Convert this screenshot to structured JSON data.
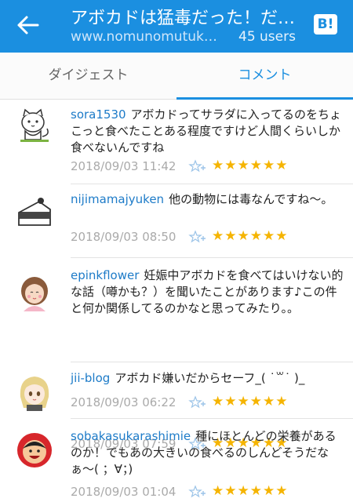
{
  "header": {
    "title": "アボカドは猛毒だった！だ…",
    "url": "www.nomunomutuk…",
    "users": "45 users",
    "hatena_label": "B!",
    "bg_color": "#1b8fe0"
  },
  "tabs": [
    {
      "label": "ダイジェスト",
      "selected": false
    },
    {
      "label": "コメント",
      "selected": true
    }
  ],
  "comments": [
    {
      "user": "sora1530",
      "text": "アボカドってサラダに入ってるのをちょこっと食べたことある程度ですけど人間くらいしか食べないんですね",
      "date": "2018/09/03 11:42",
      "stars": "★★★★★★",
      "avatar": "cat-avatar-icon"
    },
    {
      "user": "nijimamajyuken",
      "text": "他の動物には毒なんですね〜。",
      "date": "2018/09/03 08:50",
      "stars": "★★★★★★",
      "avatar": "cake-avatar-icon"
    },
    {
      "user": "epinkflower",
      "text": "妊娠中アボカドを食べてはいけない的な話（噂かも？）を聞いたことがあります♪この件と何か関係してるのかなと思ってみたり。。",
      "date": "2018/09/03 07:59",
      "stars": "★★★★★★",
      "avatar": "woman-avatar-icon"
    },
    {
      "user": "jii-blog",
      "text": "アボカド嫌いだからセーフ_( ˙꒳˙ )_",
      "date": "2018/09/03 06:22",
      "stars": "★★★★★★",
      "avatar": "girl-avatar-icon"
    },
    {
      "user": "sobakasukarashimie",
      "text": "種にほとんどの栄養があるのか！でもあの大きいの食べるのしんどそうだなぁ〜( ；∀；)",
      "date": "2018/09/03 01:04",
      "stars": "★★★★★★",
      "avatar": "face-avatar-icon"
    }
  ]
}
